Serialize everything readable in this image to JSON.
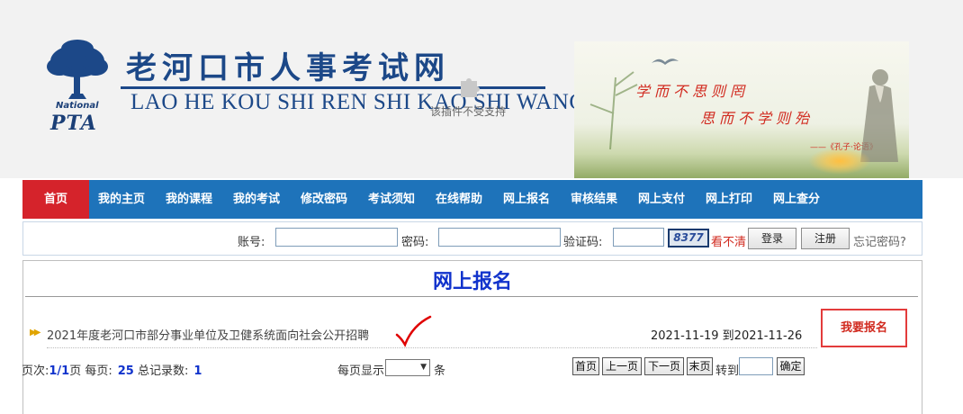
{
  "header": {
    "site_title": "老河口市人事考试网",
    "site_subtitle": "LAO HE KOU SHI REN SHI KAO SHI WANG",
    "plugin_message": "该插件不受支持",
    "logo_national": "National",
    "logo_pta": "PTA",
    "banner_verse_1": "学而不思则罔",
    "banner_verse_2": "思而不学则殆",
    "banner_source": "——《孔子·论语》"
  },
  "nav": {
    "items": [
      {
        "label": "首页",
        "active": true
      },
      {
        "label": "我的主页"
      },
      {
        "label": "我的课程"
      },
      {
        "label": "我的考试"
      },
      {
        "label": "修改密码"
      },
      {
        "label": "考试须知"
      },
      {
        "label": "在线帮助"
      },
      {
        "label": "网上报名"
      },
      {
        "label": "审核结果"
      },
      {
        "label": "网上支付"
      },
      {
        "label": "网上打印"
      },
      {
        "label": "网上查分"
      }
    ]
  },
  "login": {
    "account_label": "账号:",
    "account_value": "",
    "password_label": "密码:",
    "password_value": "",
    "captcha_label": "验证码:",
    "captcha_value": "",
    "captcha_image_text": "8377",
    "cant_see_1": "看",
    "cant_see_2": "不清",
    "login_button": "登录",
    "register_button": "注册",
    "forgot_link": "忘记密码?"
  },
  "main": {
    "title": "网上报名",
    "listing": {
      "title": "2021年度老河口市部分事业单位及卫健系统面向社会公开招聘",
      "dates": "2021-11-19 到2021-11-26",
      "apply_label": "我要报名"
    },
    "pager": {
      "page_label": "页次:",
      "page_value": "1/1",
      "page_unit": "页 每页:",
      "per_page_value": "25",
      "total_label": " 总记录数:",
      "total_value": "1",
      "per_page_show_label": "每页显示",
      "per_page_select_value": "",
      "per_page_unit": "条",
      "first": "首页",
      "prev": "上一页",
      "next": "下一页",
      "last": "末页",
      "goto_label": "转到",
      "goto_value": "",
      "confirm": "确定"
    }
  },
  "colors": {
    "nav_bg": "#1e73ba",
    "nav_active": "#d5232b",
    "title_blue": "#1133cc",
    "brand_navy": "#1c4888",
    "accent_red": "#d12a1f"
  }
}
